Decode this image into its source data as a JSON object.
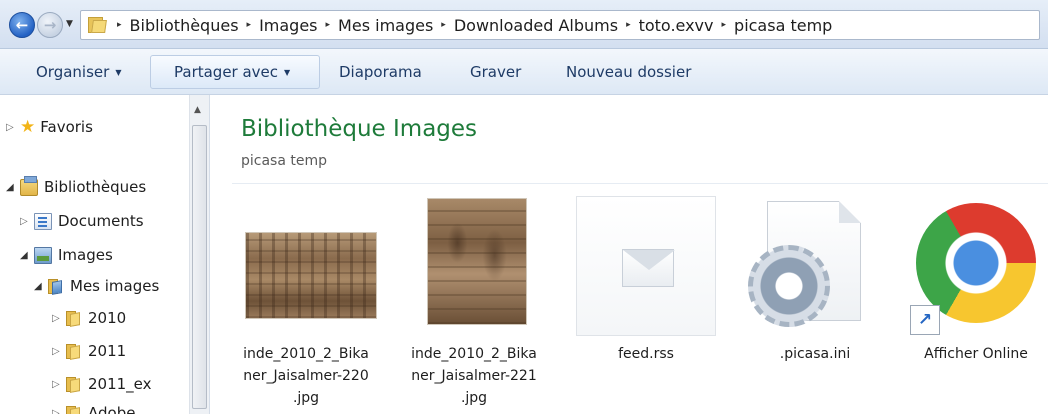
{
  "address_bar": {
    "breadcrumbs": [
      "Bibliothèques",
      "Images",
      "Mes images",
      "Downloaded Albums",
      "toto.exvv",
      "picasa temp"
    ],
    "separator": "▸"
  },
  "toolbar": {
    "organize_label": "Organiser",
    "share_label": "Partager avec",
    "slideshow_label": "Diaporama",
    "burn_label": "Graver",
    "new_folder_label": "Nouveau dossier"
  },
  "nav_tree": {
    "favorites": "Favoris",
    "libraries": "Bibliothèques",
    "documents": "Documents",
    "images": "Images",
    "my_images": "Mes images",
    "folders": [
      "2010",
      "2011",
      "2011_ex",
      "Adobe"
    ]
  },
  "content": {
    "title": "Bibliothèque Images",
    "subtitle": "picasa temp",
    "files": [
      {
        "name": "inde_2010_2_Bikaner_Jaisalmer-220.jpg",
        "line1": "inde_2010_2_Bika",
        "line2": "ner_Jaisalmer-220",
        "line3": ".jpg"
      },
      {
        "name": "inde_2010_2_Bikaner_Jaisalmer-221.jpg",
        "line1": "inde_2010_2_Bika",
        "line2": "ner_Jaisalmer-221",
        "line3": ".jpg"
      },
      {
        "name": "feed.rss",
        "line1": "feed.rss"
      },
      {
        "name": ".picasa.ini",
        "line1": ".picasa.ini"
      },
      {
        "name": "Afficher Online",
        "line1": "Afficher Online"
      }
    ]
  },
  "colors": {
    "title_green": "#1e7b3a",
    "toolbar_text": "#1e3b66"
  }
}
